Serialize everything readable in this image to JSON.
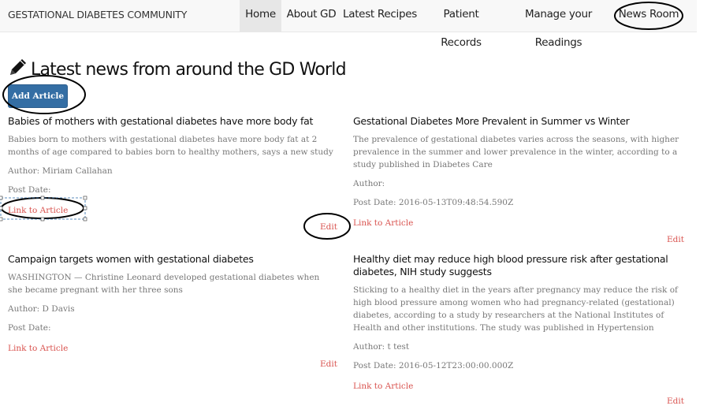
{
  "brand": "GESTATIONAL DIABETES COMMUNITY",
  "nav": {
    "home": "Home",
    "about": "About GD",
    "recipes": "Latest Recipes",
    "records": "Patient Records",
    "readings": "Manage your Readings",
    "news": "News Room"
  },
  "page": {
    "title": "Latest news from around the GD World",
    "add_button": "Add Article"
  },
  "articles": [
    {
      "title": "Babies of mothers with gestational diabetes have more body fat",
      "description": "Babies born to mothers with gestational diabetes have more body fat at 2 months of age compared to babies born to healthy mothers, says a new study",
      "author": "Author: Miriam Callahan",
      "post_date": "Post Date:",
      "link": "Link to Article",
      "edit": "Edit"
    },
    {
      "title": "Gestational Diabetes More Prevalent in Summer vs Winter",
      "description": "The prevalence of gestational diabetes varies across the seasons, with higher prevalence in the summer and lower prevalence in the winter, according to a study published in Diabetes Care",
      "author": "Author:",
      "post_date": "Post Date: 2016-05-13T09:48:54.590Z",
      "link": "Link to Article",
      "edit": "Edit"
    },
    {
      "title": "Campaign targets women with gestational diabetes",
      "description": "WASHINGTON — Christine Leonard developed gestational diabetes when she became pregnant with her three sons",
      "author": "Author: D Davis",
      "post_date": "Post Date:",
      "link": "Link to Article",
      "edit": "Edit"
    },
    {
      "title": "Healthy diet may reduce high blood pressure risk after gestational diabetes, NIH study suggests",
      "description": "Sticking to a healthy diet in the years after pregnancy may reduce the risk of high blood pressure among women who had pregnancy-related (gestational) diabetes, according to a study by researchers at the National Institutes of Health and other institutions. The study was published in Hypertension",
      "author": "Author: t test",
      "post_date": "Post Date: 2016-05-12T23:00:00.000Z",
      "link": "Link to Article",
      "edit": "Edit"
    }
  ],
  "colors": {
    "button_bg": "#346ea4",
    "link": "#d9534f",
    "muted_text": "#777777",
    "nav_active_bg": "#e7e7e7"
  }
}
